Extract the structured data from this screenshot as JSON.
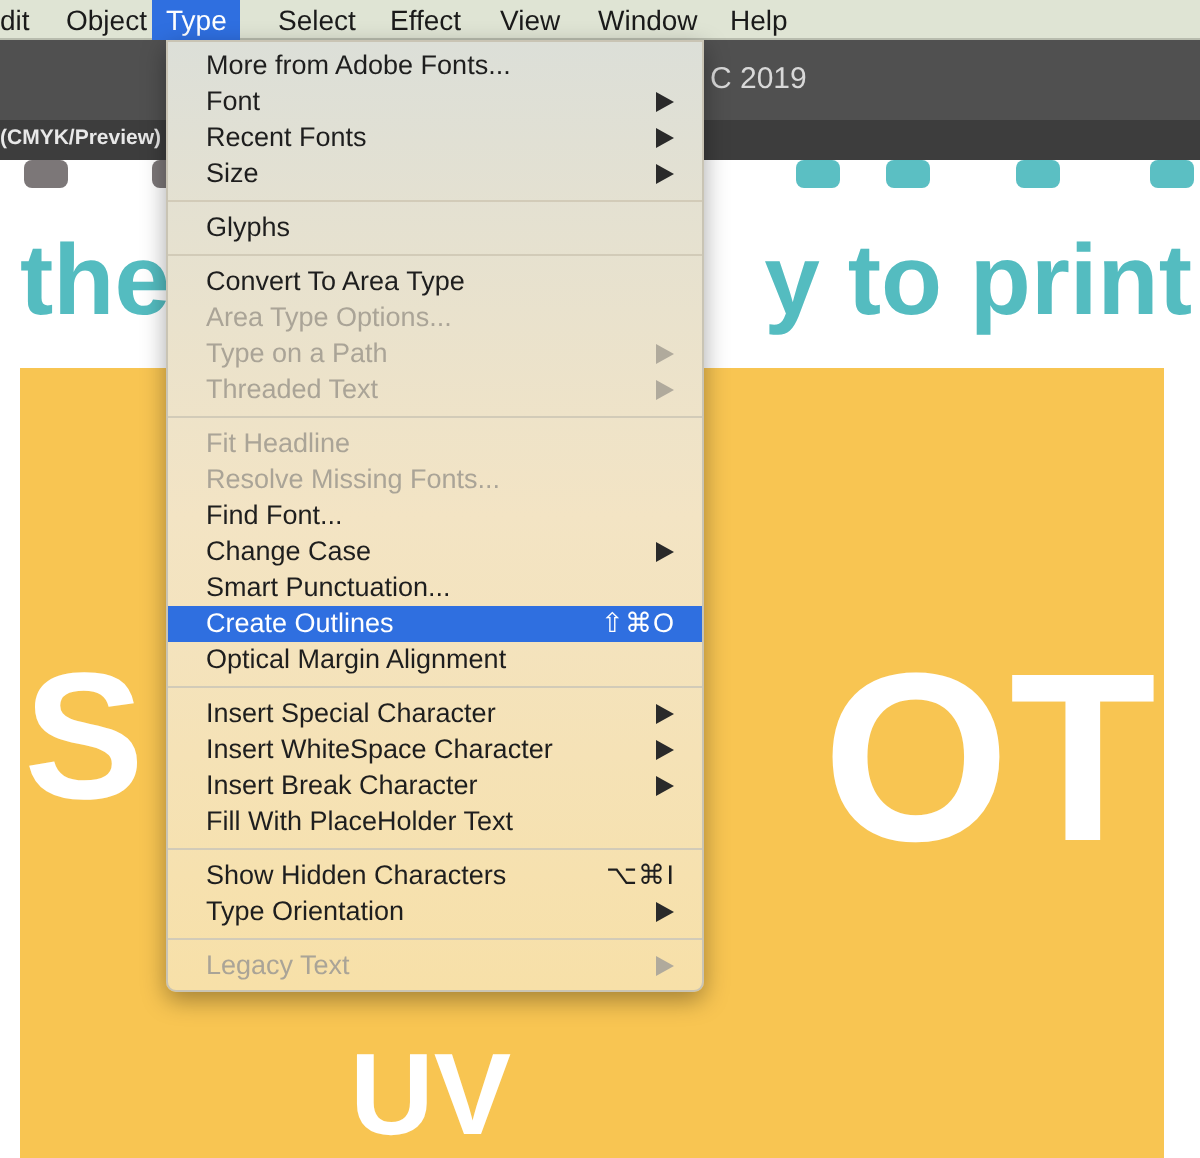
{
  "menu_bar": [
    {
      "label": "dit",
      "selected": false
    },
    {
      "label": "Object",
      "selected": false
    },
    {
      "label": "Type",
      "selected": true
    },
    {
      "label": "Select",
      "selected": false
    },
    {
      "label": "Effect",
      "selected": false
    },
    {
      "label": "View",
      "selected": false
    },
    {
      "label": "Window",
      "selected": false
    },
    {
      "label": "Help",
      "selected": false
    }
  ],
  "title_bar": {
    "title": "C 2019"
  },
  "document_tab": {
    "label": "(CMYK/Preview)"
  },
  "canvas": {
    "heading_left": "the",
    "heading_right": "y to print",
    "big_left": "S",
    "big_right": "OT",
    "big_bottom": "UV"
  },
  "menu": {
    "sections": [
      [
        {
          "label": "More from Adobe Fonts...",
          "disabled": false,
          "submenu": false,
          "selected": false
        },
        {
          "label": "Font",
          "disabled": false,
          "submenu": true,
          "selected": false
        },
        {
          "label": "Recent Fonts",
          "disabled": false,
          "submenu": true,
          "selected": false
        },
        {
          "label": "Size",
          "disabled": false,
          "submenu": true,
          "selected": false
        }
      ],
      [
        {
          "label": "Glyphs",
          "disabled": false,
          "submenu": false,
          "selected": false
        }
      ],
      [
        {
          "label": "Convert To Area Type",
          "disabled": false,
          "submenu": false,
          "selected": false
        },
        {
          "label": "Area Type Options...",
          "disabled": true,
          "submenu": false,
          "selected": false
        },
        {
          "label": "Type on a Path",
          "disabled": true,
          "submenu": true,
          "selected": false
        },
        {
          "label": "Threaded Text",
          "disabled": true,
          "submenu": true,
          "selected": false
        }
      ],
      [
        {
          "label": "Fit Headline",
          "disabled": true,
          "submenu": false,
          "selected": false
        },
        {
          "label": "Resolve Missing Fonts...",
          "disabled": true,
          "submenu": false,
          "selected": false
        },
        {
          "label": "Find Font...",
          "disabled": false,
          "submenu": false,
          "selected": false
        },
        {
          "label": "Change Case",
          "disabled": false,
          "submenu": true,
          "selected": false
        },
        {
          "label": "Smart Punctuation...",
          "disabled": false,
          "submenu": false,
          "selected": false
        },
        {
          "label": "Create Outlines",
          "disabled": false,
          "submenu": false,
          "selected": true,
          "shortcut": "⇧⌘O"
        },
        {
          "label": "Optical Margin Alignment",
          "disabled": false,
          "submenu": false,
          "selected": false
        }
      ],
      [
        {
          "label": "Insert Special Character",
          "disabled": false,
          "submenu": true,
          "selected": false
        },
        {
          "label": "Insert WhiteSpace Character",
          "disabled": false,
          "submenu": true,
          "selected": false
        },
        {
          "label": "Insert Break Character",
          "disabled": false,
          "submenu": true,
          "selected": false
        },
        {
          "label": "Fill With PlaceHolder Text",
          "disabled": false,
          "submenu": false,
          "selected": false
        }
      ],
      [
        {
          "label": "Show Hidden Characters",
          "disabled": false,
          "submenu": false,
          "selected": false,
          "shortcut": "⌥⌘I"
        },
        {
          "label": "Type Orientation",
          "disabled": false,
          "submenu": true,
          "selected": false
        }
      ],
      [
        {
          "label": "Legacy Text",
          "disabled": true,
          "submenu": true,
          "selected": false
        }
      ]
    ]
  }
}
